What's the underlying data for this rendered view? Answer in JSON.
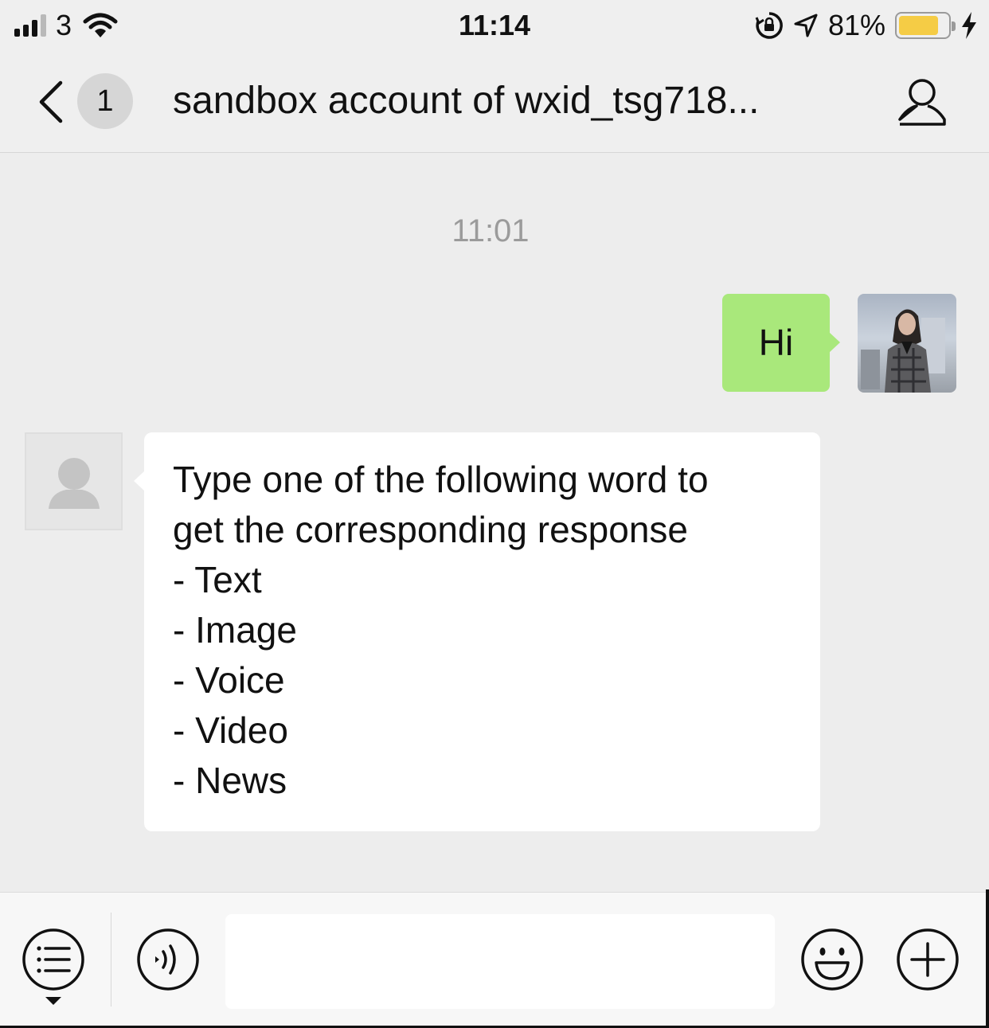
{
  "status_bar": {
    "carrier": "3",
    "time": "11:14",
    "battery_percent": "81%",
    "battery_level": 0.81,
    "signal_bars": 3,
    "icons": [
      "signal-icon",
      "wifi-icon",
      "orientation-lock-icon",
      "location-arrow-icon",
      "battery-icon",
      "charging-bolt-icon"
    ]
  },
  "nav": {
    "unread_count": "1",
    "title": "sandbox account of wxid_tsg718...",
    "icons": [
      "back-chevron-icon",
      "profile-icon"
    ]
  },
  "chat": {
    "timestamp": "11:01",
    "sent_message": "Hi",
    "received_lines": [
      "Type one of the following word to",
      "get the corresponding response",
      "- Text",
      "- Image",
      "- Voice",
      "- Video",
      "- News"
    ]
  },
  "input_bar": {
    "message_value": "",
    "icons": [
      "menu-list-icon",
      "voice-icon",
      "emoji-icon",
      "plus-icon"
    ]
  },
  "colors": {
    "background": "#ededed",
    "sent_bubble": "#a9e87b",
    "received_bubble": "#ffffff",
    "battery_fill": "#f5cc45"
  }
}
